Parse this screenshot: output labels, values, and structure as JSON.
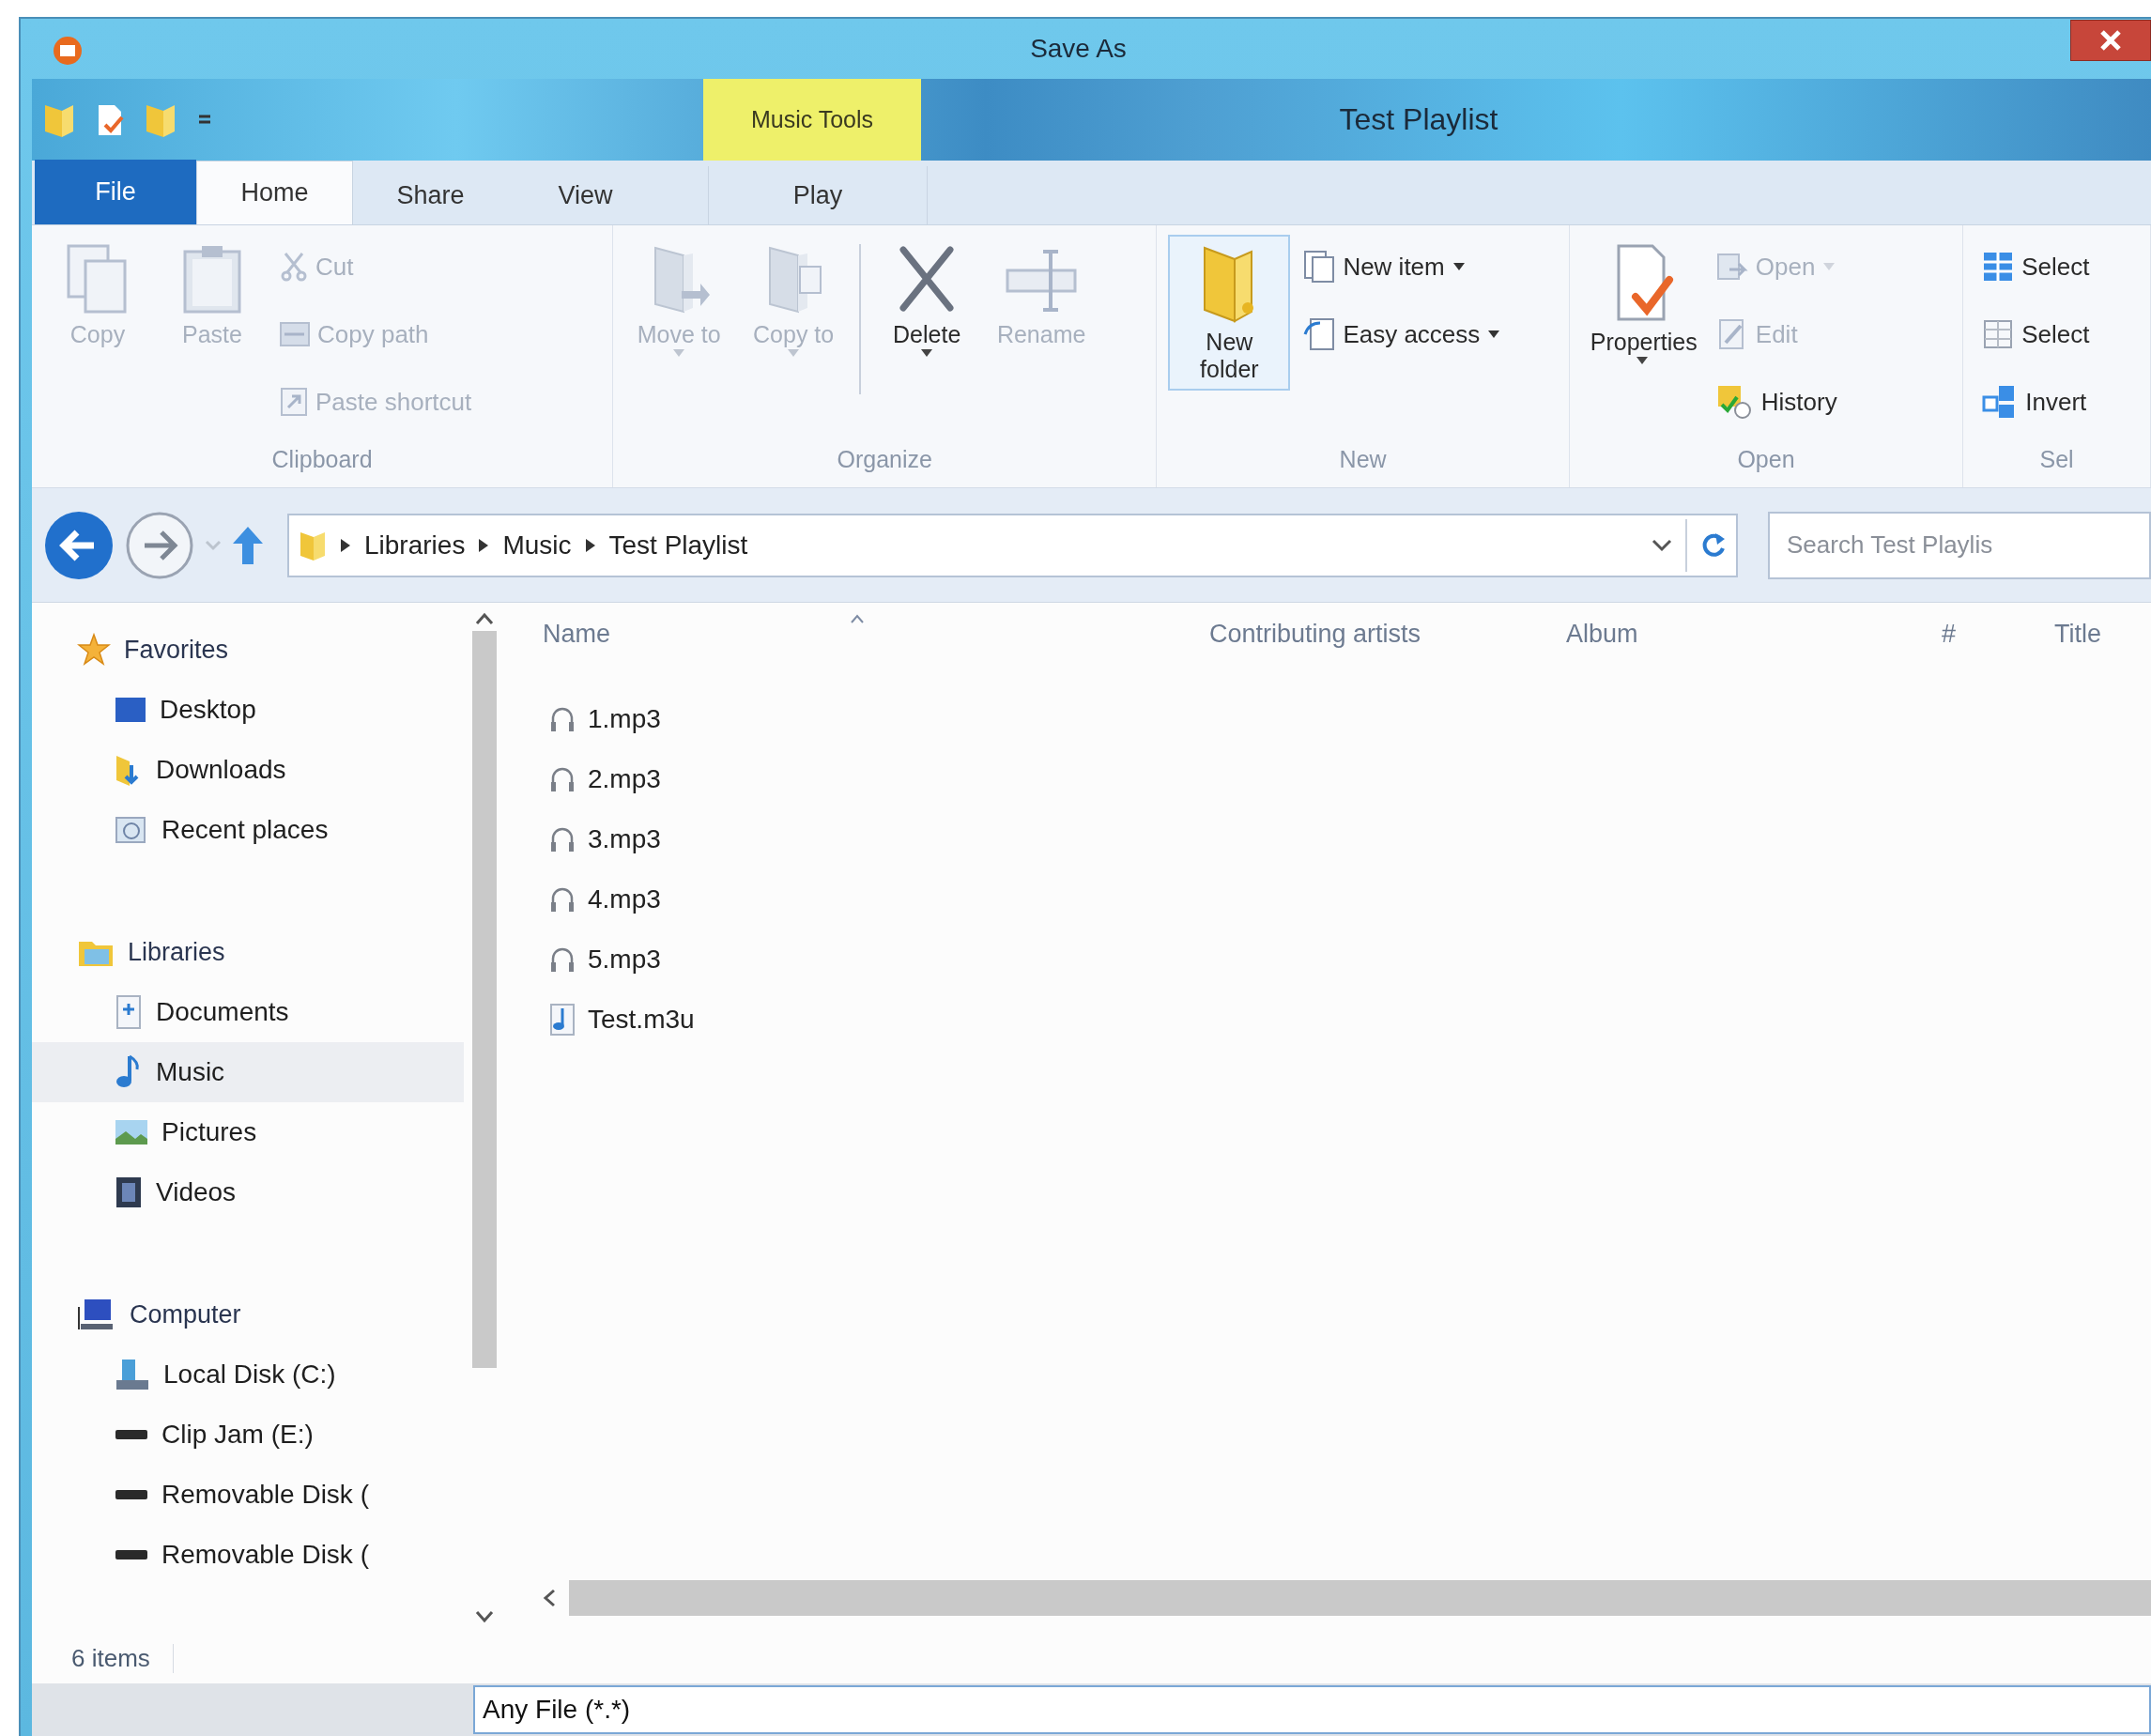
{
  "background_window": {
    "title": "Save As",
    "file_type": "Any File (*.*)"
  },
  "window": {
    "title": "Test Playlist",
    "context_tab_group": "Music Tools"
  },
  "ribbon_tabs": [
    {
      "label": "File",
      "kind": "backstage",
      "selected": false
    },
    {
      "label": "Home",
      "kind": "normal",
      "selected": true
    },
    {
      "label": "Share",
      "kind": "normal",
      "selected": false
    },
    {
      "label": "View",
      "kind": "normal",
      "selected": false
    },
    {
      "label": "Play",
      "kind": "context",
      "selected": false
    }
  ],
  "ribbon_groups": [
    {
      "label": "Clipboard",
      "commands": [
        {
          "label": "Copy",
          "kind": "large",
          "disabled": true,
          "dropdown": false,
          "hovered": false
        },
        {
          "label": "Paste",
          "kind": "large",
          "disabled": true,
          "dropdown": false,
          "hovered": false
        },
        {
          "label": "Cut",
          "kind": "small",
          "disabled": true,
          "dropdown": false,
          "hovered": false
        },
        {
          "label": "Copy path",
          "kind": "small",
          "disabled": true,
          "dropdown": false,
          "hovered": false
        },
        {
          "label": "Paste shortcut",
          "kind": "small",
          "disabled": true,
          "dropdown": false,
          "hovered": false
        }
      ]
    },
    {
      "label": "Organize",
      "commands": [
        {
          "label": "Move to",
          "kind": "large",
          "disabled": true,
          "dropdown": true,
          "hovered": false
        },
        {
          "label": "Copy to",
          "kind": "large",
          "disabled": true,
          "dropdown": true,
          "hovered": false
        },
        {
          "label": "Delete",
          "kind": "large",
          "disabled": false,
          "dropdown": true,
          "hovered": false
        },
        {
          "label": "Rename",
          "kind": "large",
          "disabled": true,
          "dropdown": false,
          "hovered": false
        }
      ]
    },
    {
      "label": "New",
      "commands": [
        {
          "label": "New folder",
          "kind": "large",
          "disabled": false,
          "dropdown": false,
          "hovered": true
        },
        {
          "label": "New item",
          "kind": "small",
          "disabled": false,
          "dropdown": true,
          "hovered": false
        },
        {
          "label": "Easy access",
          "kind": "small",
          "disabled": false,
          "dropdown": true,
          "hovered": false
        }
      ]
    },
    {
      "label": "Open",
      "commands": [
        {
          "label": "Properties",
          "kind": "large",
          "disabled": false,
          "dropdown": true,
          "hovered": false
        },
        {
          "label": "Open",
          "kind": "small",
          "disabled": true,
          "dropdown": true,
          "hovered": false
        },
        {
          "label": "Edit",
          "kind": "small",
          "disabled": true,
          "dropdown": false,
          "hovered": false
        },
        {
          "label": "History",
          "kind": "small",
          "disabled": false,
          "dropdown": false,
          "hovered": false
        }
      ]
    },
    {
      "label": "Sel",
      "commands": [
        {
          "label": "Select",
          "kind": "small",
          "disabled": false,
          "dropdown": false,
          "hovered": false
        },
        {
          "label": "Select",
          "kind": "small",
          "disabled": false,
          "dropdown": false,
          "hovered": false
        },
        {
          "label": "Invert",
          "kind": "small",
          "disabled": false,
          "dropdown": false,
          "hovered": false
        }
      ]
    }
  ],
  "address_bar": {
    "breadcrumbs": [
      "Libraries",
      "Music",
      "Test Playlist"
    ]
  },
  "search": {
    "placeholder": "Search Test Playlis"
  },
  "navigation_pane": {
    "sections": [
      {
        "label": "Favorites",
        "selected": false,
        "children": [
          {
            "label": "Desktop",
            "selected": false
          },
          {
            "label": "Downloads",
            "selected": false
          },
          {
            "label": "Recent places",
            "selected": false
          }
        ]
      },
      {
        "label": "Libraries",
        "selected": false,
        "children": [
          {
            "label": "Documents",
            "selected": false
          },
          {
            "label": "Music",
            "selected": true
          },
          {
            "label": "Pictures",
            "selected": false
          },
          {
            "label": "Videos",
            "selected": false
          }
        ]
      },
      {
        "label": "Computer",
        "selected": false,
        "children": [
          {
            "label": "Local Disk (C:)",
            "selected": false
          },
          {
            "label": "Clip Jam  (E:)",
            "selected": false
          },
          {
            "label": "Removable Disk (",
            "selected": false
          },
          {
            "label": "Removable Disk (",
            "selected": false
          }
        ]
      }
    ]
  },
  "file_list": {
    "columns": [
      "Name",
      "Contributing artists",
      "Album",
      "#",
      "Title"
    ],
    "files": [
      {
        "name": "1.mp3",
        "kind": "audio"
      },
      {
        "name": "2.mp3",
        "kind": "audio"
      },
      {
        "name": "3.mp3",
        "kind": "audio"
      },
      {
        "name": "4.mp3",
        "kind": "audio"
      },
      {
        "name": "5.mp3",
        "kind": "audio"
      },
      {
        "name": "Test.m3u",
        "kind": "playlist"
      }
    ]
  },
  "status_bar": {
    "item_count": "6 items"
  }
}
